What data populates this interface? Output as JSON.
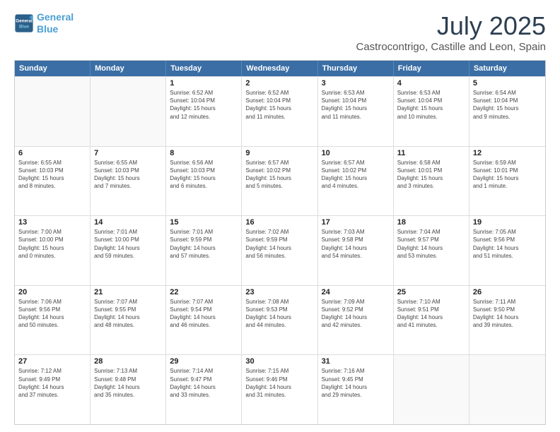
{
  "header": {
    "logo_line1": "General",
    "logo_line2": "Blue",
    "title": "July 2025",
    "subtitle": "Castrocontrigo, Castille and Leon, Spain"
  },
  "days_of_week": [
    "Sunday",
    "Monday",
    "Tuesday",
    "Wednesday",
    "Thursday",
    "Friday",
    "Saturday"
  ],
  "weeks": [
    [
      {
        "day": "",
        "info": ""
      },
      {
        "day": "",
        "info": ""
      },
      {
        "day": "1",
        "info": "Sunrise: 6:52 AM\nSunset: 10:04 PM\nDaylight: 15 hours\nand 12 minutes."
      },
      {
        "day": "2",
        "info": "Sunrise: 6:52 AM\nSunset: 10:04 PM\nDaylight: 15 hours\nand 11 minutes."
      },
      {
        "day": "3",
        "info": "Sunrise: 6:53 AM\nSunset: 10:04 PM\nDaylight: 15 hours\nand 11 minutes."
      },
      {
        "day": "4",
        "info": "Sunrise: 6:53 AM\nSunset: 10:04 PM\nDaylight: 15 hours\nand 10 minutes."
      },
      {
        "day": "5",
        "info": "Sunrise: 6:54 AM\nSunset: 10:04 PM\nDaylight: 15 hours\nand 9 minutes."
      }
    ],
    [
      {
        "day": "6",
        "info": "Sunrise: 6:55 AM\nSunset: 10:03 PM\nDaylight: 15 hours\nand 8 minutes."
      },
      {
        "day": "7",
        "info": "Sunrise: 6:55 AM\nSunset: 10:03 PM\nDaylight: 15 hours\nand 7 minutes."
      },
      {
        "day": "8",
        "info": "Sunrise: 6:56 AM\nSunset: 10:03 PM\nDaylight: 15 hours\nand 6 minutes."
      },
      {
        "day": "9",
        "info": "Sunrise: 6:57 AM\nSunset: 10:02 PM\nDaylight: 15 hours\nand 5 minutes."
      },
      {
        "day": "10",
        "info": "Sunrise: 6:57 AM\nSunset: 10:02 PM\nDaylight: 15 hours\nand 4 minutes."
      },
      {
        "day": "11",
        "info": "Sunrise: 6:58 AM\nSunset: 10:01 PM\nDaylight: 15 hours\nand 3 minutes."
      },
      {
        "day": "12",
        "info": "Sunrise: 6:59 AM\nSunset: 10:01 PM\nDaylight: 15 hours\nand 1 minute."
      }
    ],
    [
      {
        "day": "13",
        "info": "Sunrise: 7:00 AM\nSunset: 10:00 PM\nDaylight: 15 hours\nand 0 minutes."
      },
      {
        "day": "14",
        "info": "Sunrise: 7:01 AM\nSunset: 10:00 PM\nDaylight: 14 hours\nand 59 minutes."
      },
      {
        "day": "15",
        "info": "Sunrise: 7:01 AM\nSunset: 9:59 PM\nDaylight: 14 hours\nand 57 minutes."
      },
      {
        "day": "16",
        "info": "Sunrise: 7:02 AM\nSunset: 9:59 PM\nDaylight: 14 hours\nand 56 minutes."
      },
      {
        "day": "17",
        "info": "Sunrise: 7:03 AM\nSunset: 9:58 PM\nDaylight: 14 hours\nand 54 minutes."
      },
      {
        "day": "18",
        "info": "Sunrise: 7:04 AM\nSunset: 9:57 PM\nDaylight: 14 hours\nand 53 minutes."
      },
      {
        "day": "19",
        "info": "Sunrise: 7:05 AM\nSunset: 9:56 PM\nDaylight: 14 hours\nand 51 minutes."
      }
    ],
    [
      {
        "day": "20",
        "info": "Sunrise: 7:06 AM\nSunset: 9:56 PM\nDaylight: 14 hours\nand 50 minutes."
      },
      {
        "day": "21",
        "info": "Sunrise: 7:07 AM\nSunset: 9:55 PM\nDaylight: 14 hours\nand 48 minutes."
      },
      {
        "day": "22",
        "info": "Sunrise: 7:07 AM\nSunset: 9:54 PM\nDaylight: 14 hours\nand 46 minutes."
      },
      {
        "day": "23",
        "info": "Sunrise: 7:08 AM\nSunset: 9:53 PM\nDaylight: 14 hours\nand 44 minutes."
      },
      {
        "day": "24",
        "info": "Sunrise: 7:09 AM\nSunset: 9:52 PM\nDaylight: 14 hours\nand 42 minutes."
      },
      {
        "day": "25",
        "info": "Sunrise: 7:10 AM\nSunset: 9:51 PM\nDaylight: 14 hours\nand 41 minutes."
      },
      {
        "day": "26",
        "info": "Sunrise: 7:11 AM\nSunset: 9:50 PM\nDaylight: 14 hours\nand 39 minutes."
      }
    ],
    [
      {
        "day": "27",
        "info": "Sunrise: 7:12 AM\nSunset: 9:49 PM\nDaylight: 14 hours\nand 37 minutes."
      },
      {
        "day": "28",
        "info": "Sunrise: 7:13 AM\nSunset: 9:48 PM\nDaylight: 14 hours\nand 35 minutes."
      },
      {
        "day": "29",
        "info": "Sunrise: 7:14 AM\nSunset: 9:47 PM\nDaylight: 14 hours\nand 33 minutes."
      },
      {
        "day": "30",
        "info": "Sunrise: 7:15 AM\nSunset: 9:46 PM\nDaylight: 14 hours\nand 31 minutes."
      },
      {
        "day": "31",
        "info": "Sunrise: 7:16 AM\nSunset: 9:45 PM\nDaylight: 14 hours\nand 29 minutes."
      },
      {
        "day": "",
        "info": ""
      },
      {
        "day": "",
        "info": ""
      }
    ]
  ]
}
